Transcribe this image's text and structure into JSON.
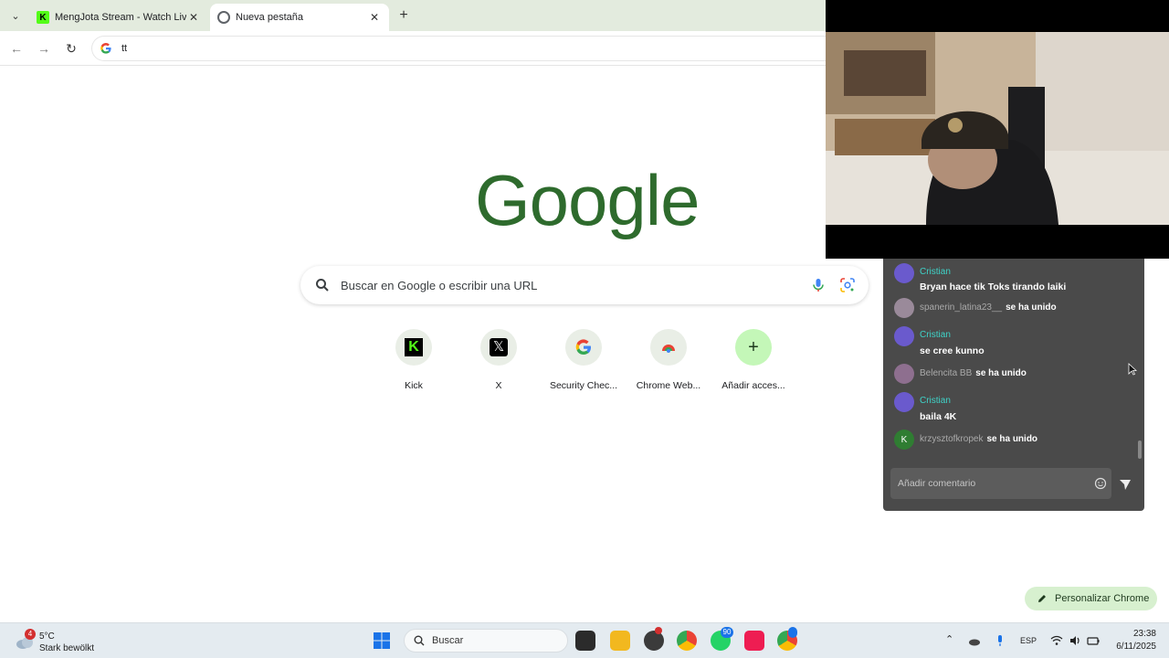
{
  "browser": {
    "tabs": [
      {
        "title": "MengJota Stream - Watch Live",
        "active": false
      },
      {
        "title": "Nueva pestaña",
        "active": true
      }
    ],
    "omnibox_value": "tt"
  },
  "newtab": {
    "logo_text": "Google",
    "search_placeholder": "Buscar en Google o escribir una URL",
    "shortcuts": [
      {
        "label": "Kick",
        "icon": "kick-icon"
      },
      {
        "label": "X",
        "icon": "x-icon"
      },
      {
        "label": "Security Chec...",
        "icon": "google-icon"
      },
      {
        "label": "Chrome Web...",
        "icon": "chrome-web-store-icon"
      },
      {
        "label": "Añadir acces...",
        "icon": "plus-icon"
      }
    ],
    "customize_label": "Personalizar Chrome"
  },
  "chat": {
    "messages": [
      {
        "user": "Cristian",
        "text": "Bryan hace tik Toks tirando laiki"
      },
      {
        "user": "spanerin_latina23__",
        "joined": "se ha unido"
      },
      {
        "user": "Cristian",
        "text": "se cree kunno"
      },
      {
        "user": "Belencita BB",
        "joined": "se ha unido"
      },
      {
        "user": "Cristian",
        "text": "baila 4K"
      },
      {
        "user": "krzysztofkropek",
        "joined": "se ha unido",
        "avatar_letter": "K"
      }
    ],
    "input_placeholder": "Añadir comentario"
  },
  "taskbar": {
    "weather": {
      "temp": "5°C",
      "condition": "Stark bewölkt",
      "badge": "4"
    },
    "search_label": "Buscar",
    "whatsapp_badge": "90",
    "lang": "ESP",
    "time": "23:38",
    "date": "6/11/2025"
  },
  "colors": {
    "accent_green": "#53fc18",
    "logo_green": "#2e6b2d",
    "chat_user": "#3fd3c8"
  }
}
